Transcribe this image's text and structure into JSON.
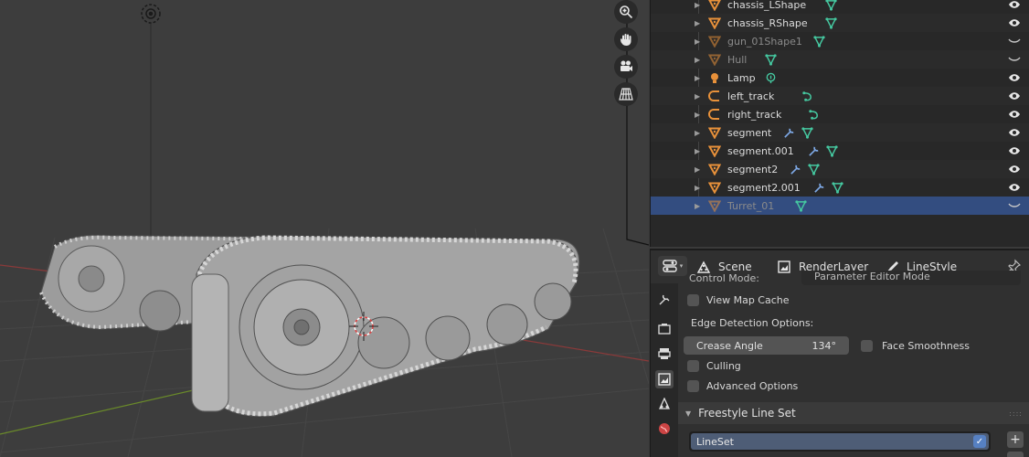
{
  "outliner": {
    "items": [
      {
        "label": "chassis_LShape",
        "type": "mesh",
        "dim": false,
        "visible": true
      },
      {
        "label": "chassis_RShape",
        "type": "mesh",
        "dim": false,
        "visible": true
      },
      {
        "label": "gun_01Shape1",
        "type": "mesh",
        "dim": true,
        "visible": false
      },
      {
        "label": "Hull",
        "type": "mesh",
        "dim": true,
        "visible": false
      },
      {
        "label": "Lamp",
        "type": "lamp",
        "dim": false,
        "visible": true
      },
      {
        "label": "left_track",
        "type": "curve",
        "dim": false,
        "visible": true
      },
      {
        "label": "right_track",
        "type": "curve",
        "dim": false,
        "visible": true
      },
      {
        "label": "segment",
        "type": "mesh_mod",
        "dim": false,
        "visible": true
      },
      {
        "label": "segment.001",
        "type": "mesh_mod",
        "dim": false,
        "visible": true
      },
      {
        "label": "segment2",
        "type": "mesh_mod",
        "dim": false,
        "visible": true
      },
      {
        "label": "segment2.001",
        "type": "mesh_mod",
        "dim": false,
        "visible": true
      },
      {
        "label": "Turret_01",
        "type": "mesh",
        "dim": true,
        "visible": false,
        "selected": true
      }
    ]
  },
  "properties": {
    "tabs": {
      "scene": "Scene",
      "render_layer": "RenderLayer",
      "line_style": "LineStyle"
    },
    "cut_row": {
      "label": "Control Mode:",
      "value": "Parameter Editor Mode"
    },
    "view_map_cache": "View Map Cache",
    "edge_detection_label": "Edge Detection Options:",
    "crease_angle": {
      "label": "Crease Angle",
      "value": "134°"
    },
    "face_smoothness": "Face Smoothness",
    "culling": "Culling",
    "advanced_options": "Advanced Options",
    "panel_title": "Freestyle Line Set",
    "lineset_item": "LineSet",
    "add_symbol": "+",
    "remove_symbol": "−"
  },
  "colors": {
    "orange_mesh": "#e8913a",
    "green_data": "#45c8a0",
    "wrench_blue": "#7ea9e6",
    "selected_row": "#334d80"
  }
}
